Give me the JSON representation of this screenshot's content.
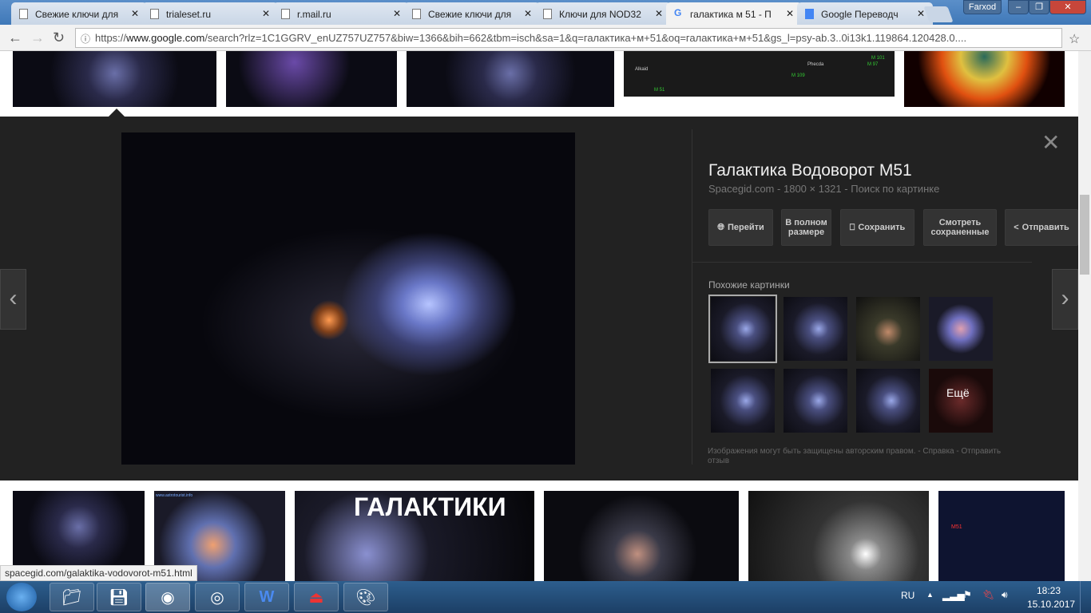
{
  "browser": {
    "tabs": [
      {
        "label": "Свежие ключи для"
      },
      {
        "label": "trialeset.ru"
      },
      {
        "label": "r.mail.ru"
      },
      {
        "label": "Свежие ключи для"
      },
      {
        "label": "Ключи для NOD32"
      },
      {
        "label": "галактика м 51 - П"
      },
      {
        "label": "Google Переводч"
      }
    ],
    "active_tab": 5,
    "user": "Farxod",
    "url_scheme": "https://",
    "url_host": "www.google.com",
    "url_rest": "/search?rlz=1C1GGRV_enUZ757UZ757&biw=1366&bih=662&tbm=isch&sa=1&q=галактика+м+51&oq=галактика+м+51&gs_l=psy-ab.3..0i13k1.119864.120428.0...."
  },
  "top_thumbs": [
    {
      "labels": [
        "Alkaid",
        "Phecda",
        "M 101",
        "M 97",
        "M 109",
        "M 51"
      ]
    }
  ],
  "detail": {
    "title": "Галактика Водоворот M51",
    "source": "Spacegid.com",
    "size": "1800 × 1321",
    "search_by_image": "Поиск по картинке",
    "sep": "-",
    "buttons": {
      "visit": "Перейти",
      "full_size": "В полном размере",
      "save": "Сохранить",
      "view_saved": "Смотреть сохраненные",
      "share": "Отправить"
    },
    "similar_heading": "Похожие картинки",
    "more": "Ещё",
    "copyright": "Изображения могут быть защищены авторским правом.",
    "help": "Справка",
    "feedback": "Отправить отзыв"
  },
  "bottom_thumbs": {
    "galaxies_caption": "ГАЛАКТИКИ",
    "site_caption": "www.astrotourist.info",
    "chart_label": "M51"
  },
  "status_url": "spacegid.com/galaktika-vodovorot-m51.html",
  "tray": {
    "lang": "RU",
    "time": "18:23",
    "date": "15.10.2017"
  }
}
